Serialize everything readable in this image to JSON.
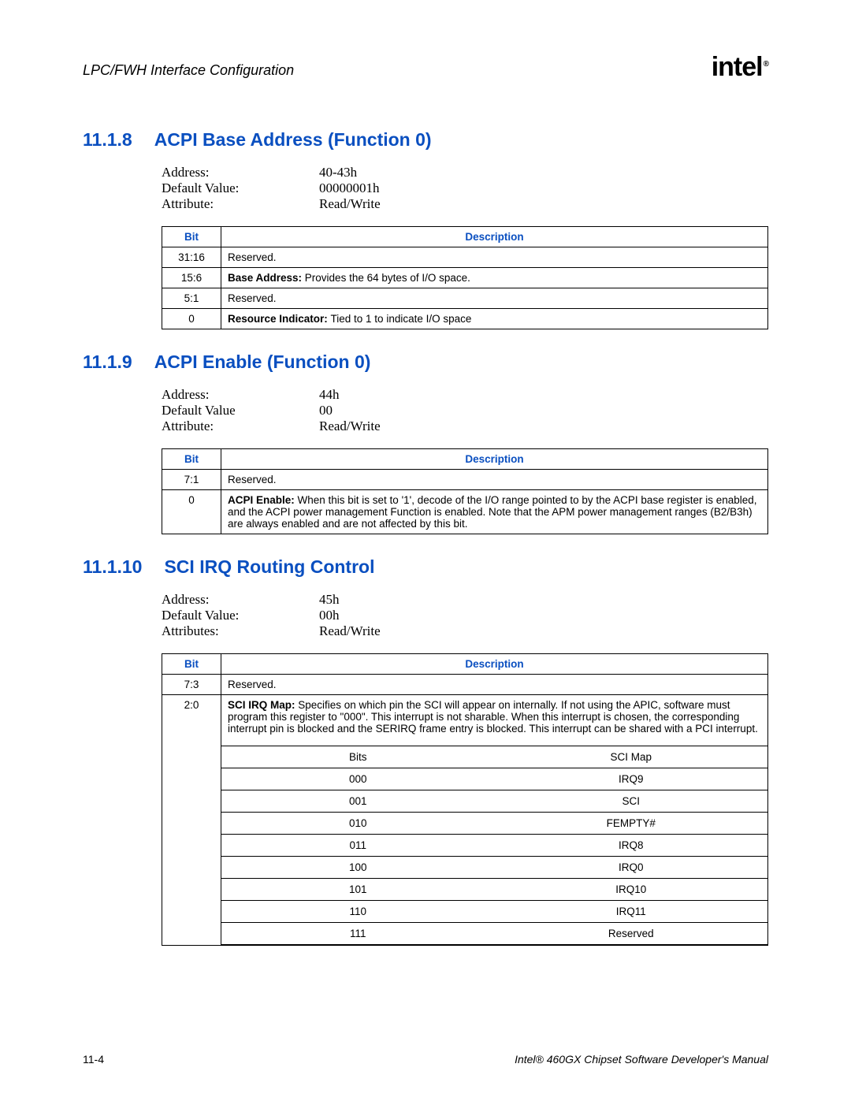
{
  "header": {
    "title": "LPC/FWH Interface Configuration",
    "logo": "intel",
    "logo_reg": "®"
  },
  "sections": [
    {
      "number": "11.1.8",
      "title": "ACPI Base Address (Function 0)",
      "attrs": [
        {
          "label": "Address:",
          "value": "40-43h"
        },
        {
          "label": "Default Value:",
          "value": "00000001h"
        },
        {
          "label": "Attribute:",
          "value": "Read/Write"
        }
      ],
      "table_headers": [
        "Bit",
        "Description"
      ],
      "rows": [
        {
          "bit": "31:16",
          "desc_bold": "",
          "desc": "Reserved."
        },
        {
          "bit": "15:6",
          "desc_bold": "Base Address: ",
          "desc": "Provides the 64 bytes of I/O space."
        },
        {
          "bit": "5:1",
          "desc_bold": "",
          "desc": "Reserved."
        },
        {
          "bit": "0",
          "desc_bold": "Resource Indicator: ",
          "desc": "Tied to 1 to indicate I/O space"
        }
      ]
    },
    {
      "number": "11.1.9",
      "title": "ACPI Enable (Function 0)",
      "attrs": [
        {
          "label": "Address:",
          "value": "44h"
        },
        {
          "label": "Default Value",
          "value": "00"
        },
        {
          "label": "Attribute:",
          "value": "Read/Write"
        }
      ],
      "table_headers": [
        "Bit",
        "Description"
      ],
      "rows": [
        {
          "bit": "7:1",
          "desc_bold": "",
          "desc": "Reserved."
        },
        {
          "bit": "0",
          "desc_bold": "ACPI Enable: ",
          "desc": "When this bit is set to '1', decode of the I/O range pointed to by the ACPI base register is enabled, and the ACPI power management Function is enabled. Note that the APM power management ranges (B2/B3h) are always enabled and are not affected by this bit."
        }
      ]
    },
    {
      "number": "11.1.10",
      "title": "SCI IRQ Routing Control",
      "attrs": [
        {
          "label": "Address:",
          "value": "45h"
        },
        {
          "label": "Default Value:",
          "value": "00h"
        },
        {
          "label": "Attributes:",
          "value": "Read/Write"
        }
      ],
      "table_headers": [
        "Bit",
        "Description"
      ],
      "rows": [
        {
          "bit": "7:3",
          "desc_bold": "",
          "desc": "Reserved."
        },
        {
          "bit": "2:0",
          "desc_bold": "SCI IRQ Map: ",
          "desc": "Specifies on which pin the SCI will appear on internally. If not using the APIC, software must program this register to \"000\". This interrupt is not sharable. When this interrupt is chosen, the corresponding interrupt pin is blocked and the SERIRQ frame entry is blocked.   This interrupt can be shared with a PCI interrupt.",
          "sub_headers": [
            "Bits",
            "SCI Map"
          ],
          "sub_rows": [
            [
              "000",
              "IRQ9"
            ],
            [
              "001",
              "SCI"
            ],
            [
              "010",
              "FEMPTY#"
            ],
            [
              "011",
              "IRQ8"
            ],
            [
              "100",
              "IRQ0"
            ],
            [
              "101",
              "IRQ10"
            ],
            [
              "110",
              "IRQ11"
            ],
            [
              "111",
              "Reserved"
            ]
          ]
        }
      ]
    }
  ],
  "footer": {
    "page": "11-4",
    "manual": "Intel® 460GX Chipset Software Developer's Manual"
  }
}
